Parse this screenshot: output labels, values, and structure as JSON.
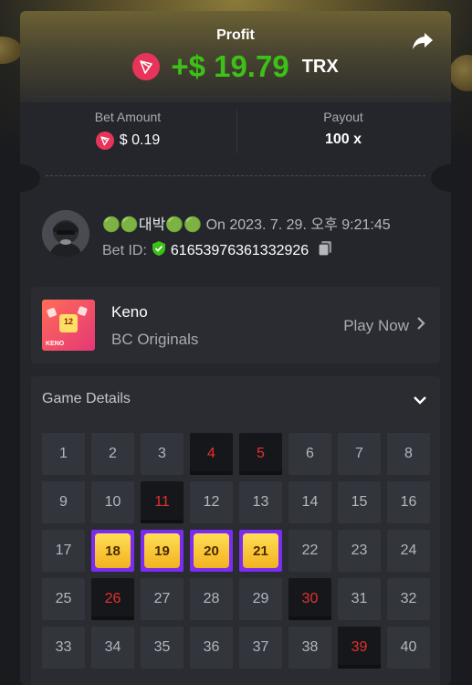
{
  "profit": {
    "label": "Profit",
    "amount": "+$ 19.79",
    "currency": "TRX"
  },
  "bet_amount": {
    "label": "Bet Amount",
    "value": "$ 0.19"
  },
  "payout": {
    "label": "Payout",
    "value": "100 x"
  },
  "user": {
    "nickname": "🟢🟢대박🟢🟢",
    "date_text": "On 2023. 7. 29. 오후 9:21:45",
    "bet_id_label": "Bet ID:",
    "bet_id": "61653976361332926"
  },
  "game": {
    "name": "Keno",
    "provider": "BC Originals",
    "play_label": "Play Now",
    "thumb_label": "KENO",
    "thumb_number": "12"
  },
  "details": {
    "title": "Game Details",
    "cells": [
      {
        "n": "1",
        "s": "normal"
      },
      {
        "n": "2",
        "s": "normal"
      },
      {
        "n": "3",
        "s": "normal"
      },
      {
        "n": "4",
        "s": "miss"
      },
      {
        "n": "5",
        "s": "miss"
      },
      {
        "n": "6",
        "s": "normal"
      },
      {
        "n": "7",
        "s": "normal"
      },
      {
        "n": "8",
        "s": "normal"
      },
      {
        "n": "9",
        "s": "normal"
      },
      {
        "n": "10",
        "s": "normal"
      },
      {
        "n": "11",
        "s": "miss"
      },
      {
        "n": "12",
        "s": "normal"
      },
      {
        "n": "13",
        "s": "normal"
      },
      {
        "n": "14",
        "s": "normal"
      },
      {
        "n": "15",
        "s": "normal"
      },
      {
        "n": "16",
        "s": "normal"
      },
      {
        "n": "17",
        "s": "normal"
      },
      {
        "n": "18",
        "s": "hit"
      },
      {
        "n": "19",
        "s": "hit"
      },
      {
        "n": "20",
        "s": "hit"
      },
      {
        "n": "21",
        "s": "hit"
      },
      {
        "n": "22",
        "s": "normal"
      },
      {
        "n": "23",
        "s": "normal"
      },
      {
        "n": "24",
        "s": "normal"
      },
      {
        "n": "25",
        "s": "normal"
      },
      {
        "n": "26",
        "s": "miss"
      },
      {
        "n": "27",
        "s": "normal"
      },
      {
        "n": "28",
        "s": "normal"
      },
      {
        "n": "29",
        "s": "normal"
      },
      {
        "n": "30",
        "s": "miss"
      },
      {
        "n": "31",
        "s": "normal"
      },
      {
        "n": "32",
        "s": "normal"
      },
      {
        "n": "33",
        "s": "normal"
      },
      {
        "n": "34",
        "s": "normal"
      },
      {
        "n": "35",
        "s": "normal"
      },
      {
        "n": "36",
        "s": "normal"
      },
      {
        "n": "37",
        "s": "normal"
      },
      {
        "n": "38",
        "s": "normal"
      },
      {
        "n": "39",
        "s": "miss"
      },
      {
        "n": "40",
        "s": "normal"
      }
    ]
  },
  "colors": {
    "profit_green": "#3bc117",
    "miss_red": "#e53030",
    "hit_purple": "#7b2cf2",
    "trx_red": "#e8345b"
  },
  "icons": [
    "trx-icon",
    "share-icon",
    "shield-check-icon",
    "copy-icon",
    "chevron-right-icon",
    "chevron-down-icon"
  ]
}
